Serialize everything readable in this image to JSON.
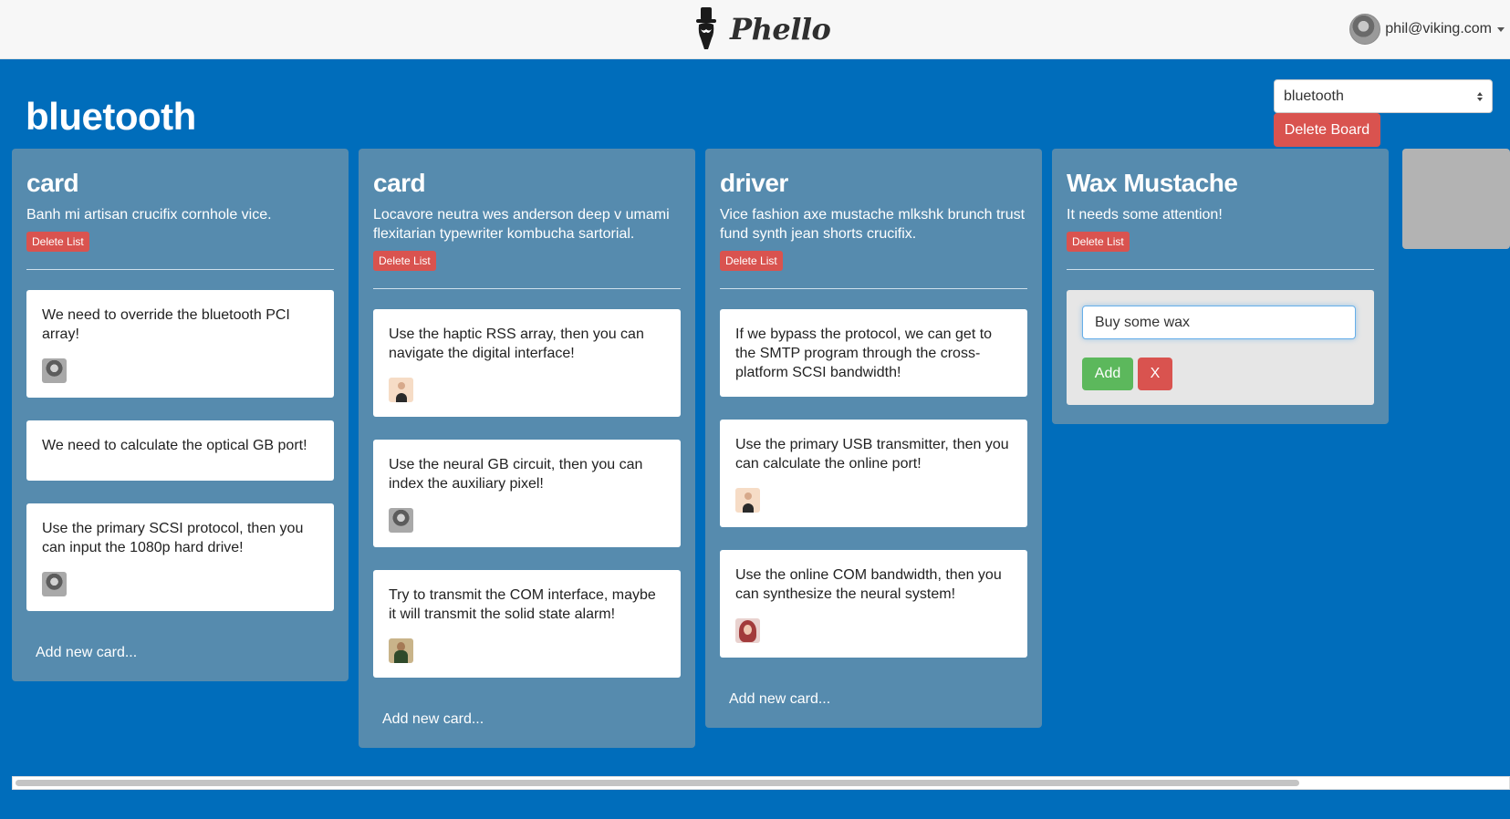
{
  "app": {
    "name": "Phello",
    "user_email": "phil@viking.com"
  },
  "board": {
    "title": "bluetooth",
    "selected": "bluetooth",
    "delete_label": "Delete Board"
  },
  "labels": {
    "delete_list": "Delete List",
    "add_new_card": "Add new card..."
  },
  "lists": [
    {
      "title": "card",
      "description": "Banh mi artisan crucifix cornhole vice.",
      "cards": [
        {
          "text": "We need to override the bluetooth PCI array!",
          "avatar": "gray-man"
        },
        {
          "text": "We need to calculate the optical GB port!",
          "avatar": null
        },
        {
          "text": "Use the primary SCSI protocol, then you can input the 1080p hard drive!",
          "avatar": "gray-man"
        }
      ]
    },
    {
      "title": "card",
      "description": "Locavore neutra wes anderson deep v umami flexitarian typewriter kombucha sartorial.",
      "cards": [
        {
          "text": "Use the haptic RSS array, then you can navigate the digital interface!",
          "avatar": "bald-man"
        },
        {
          "text": "Use the neural GB circuit, then you can index the auxiliary pixel!",
          "avatar": "gray-man"
        },
        {
          "text": "Try to transmit the COM interface, maybe it will transmit the solid state alarm!",
          "avatar": "bearded-man"
        }
      ]
    },
    {
      "title": "driver",
      "description": "Vice fashion axe mustache mlkshk brunch trust fund synth jean shorts crucifix.",
      "cards": [
        {
          "text": "If we bypass the protocol, we can get to the SMTP program through the cross-platform SCSI bandwidth!",
          "avatar": null
        },
        {
          "text": "Use the primary USB transmitter, then you can calculate the online port!",
          "avatar": "bald-man"
        },
        {
          "text": "Use the online COM bandwidth, then you can synthesize the neural system!",
          "avatar": "red-haired-woman"
        }
      ]
    },
    {
      "title": "Wax Mustache",
      "description": "It needs some attention!",
      "new_card_form": {
        "value": "Buy some wax",
        "add_label": "Add",
        "cancel_label": "X"
      }
    }
  ]
}
